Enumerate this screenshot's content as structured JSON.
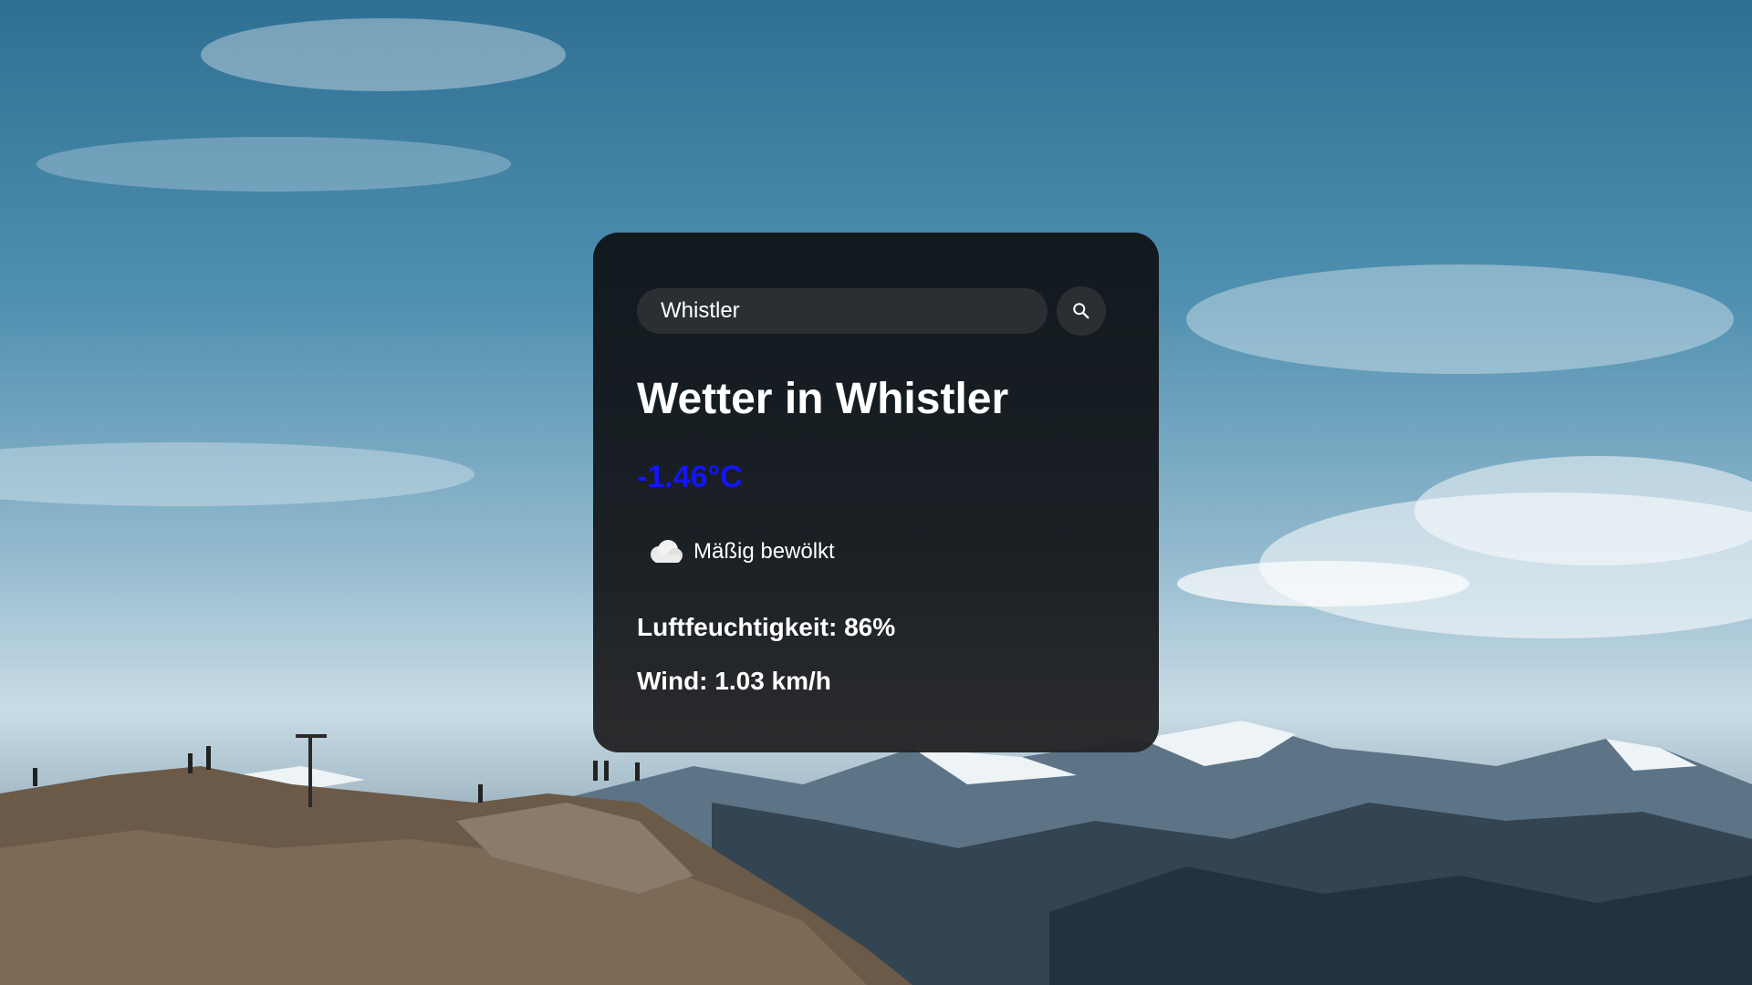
{
  "search": {
    "value": "Whistler",
    "button_icon": "search-icon"
  },
  "weather": {
    "title": "Wetter in Whistler",
    "temperature": "-1.46°C",
    "temperature_color": "#1414ff",
    "condition_icon": "cloud-icon",
    "description": "Mäßig bewölkt",
    "humidity": "Luftfeuchtigkeit: 86%",
    "wind": "Wind: 1.03 km/h"
  },
  "background": {
    "description_icon": "mountain-landscape-photo"
  }
}
